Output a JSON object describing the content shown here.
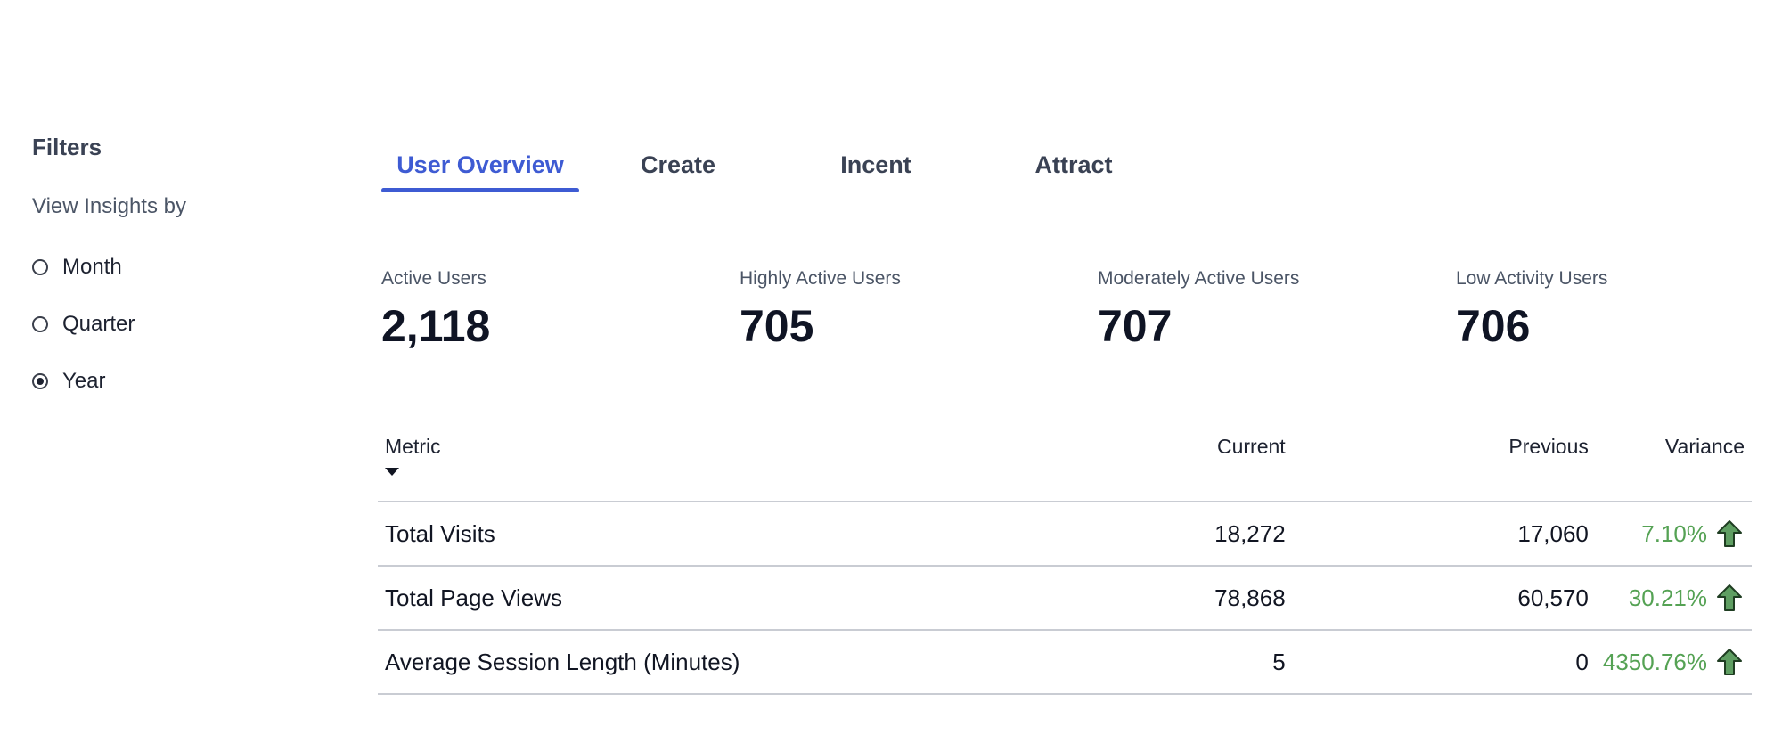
{
  "filters": {
    "title": "Filters",
    "view_by_label": "View Insights by",
    "options": [
      {
        "label": "Month",
        "checked": false
      },
      {
        "label": "Quarter",
        "checked": false
      },
      {
        "label": "Year",
        "checked": true
      }
    ]
  },
  "tabs": [
    {
      "label": "User Overview",
      "active": true
    },
    {
      "label": "Create",
      "active": false
    },
    {
      "label": "Incent",
      "active": false
    },
    {
      "label": "Attract",
      "active": false
    }
  ],
  "kpis": [
    {
      "label": "Active Users",
      "value": "2,118"
    },
    {
      "label": "Highly Active Users",
      "value": "705"
    },
    {
      "label": "Moderately Active Users",
      "value": "707"
    },
    {
      "label": "Low Activity Users",
      "value": "706"
    }
  ],
  "table": {
    "headers": {
      "metric": "Metric",
      "current": "Current",
      "previous": "Previous",
      "variance": "Variance"
    },
    "rows": [
      {
        "metric": "Total Visits",
        "current": "18,272",
        "previous": "17,060",
        "variance": "7.10%",
        "trend_icon": "up-arrow-icon"
      },
      {
        "metric": "Total Page Views",
        "current": "78,868",
        "previous": "60,570",
        "variance": "30.21%",
        "trend_icon": "up-arrow-icon"
      },
      {
        "metric": "Average Session Length (Minutes)",
        "current": "5",
        "previous": "0",
        "variance": "4350.76%",
        "trend_icon": "up-arrow-icon"
      }
    ]
  },
  "colors": {
    "accent": "#3e5bd3",
    "positive": "#55a254",
    "arrow_fill": "#5f9e62",
    "arrow_stroke": "#1f3d22"
  }
}
